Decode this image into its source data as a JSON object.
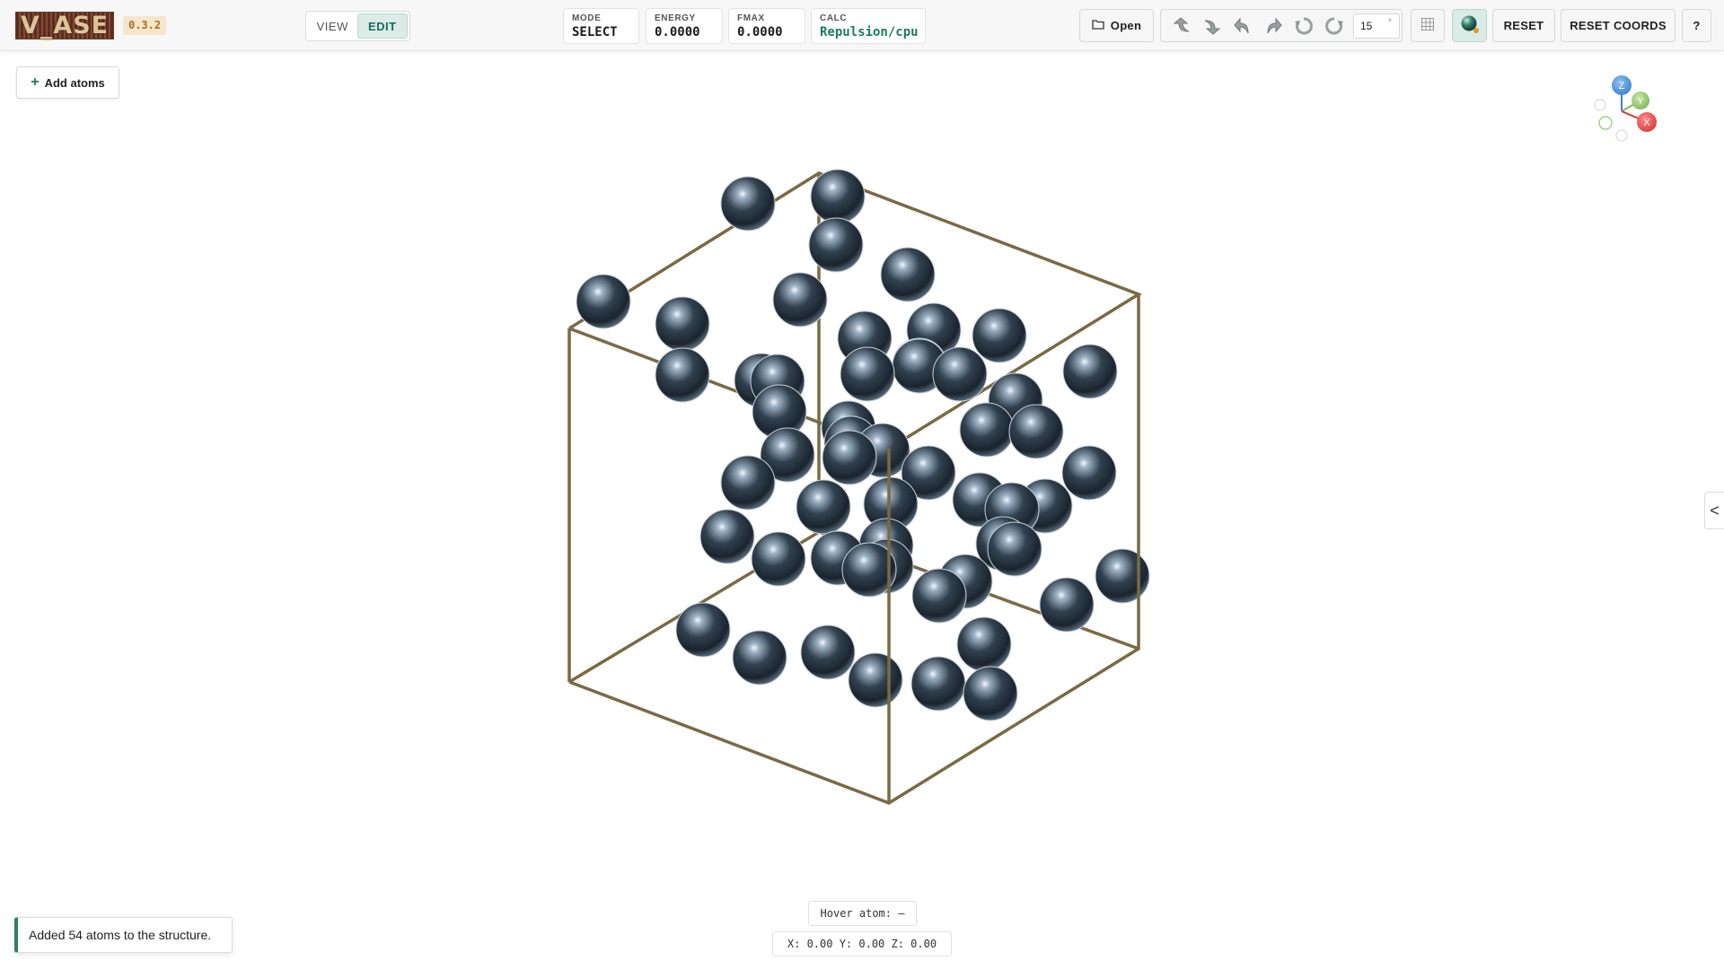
{
  "app": {
    "logo_text": "V_ASE",
    "version": "0.3.2"
  },
  "mode_toggle": {
    "options": [
      "VIEW",
      "EDIT"
    ],
    "active": "EDIT"
  },
  "stats": [
    {
      "label": "MODE",
      "value": "SELECT"
    },
    {
      "label": "ENERGY",
      "value": "0.0000"
    },
    {
      "label": "FMAX",
      "value": "0.0000"
    },
    {
      "label": "CALC",
      "value": "Repulsion/cpu"
    }
  ],
  "toolbar": {
    "open_label": "Open",
    "rotation_step": "15",
    "rotation_unit": "°",
    "reset_label": "RESET",
    "reset_coords_label": "RESET COORDS",
    "help_label": "?",
    "rotate_icons": [
      "rotate-up-icon",
      "rotate-down-icon",
      "rotate-left-icon",
      "rotate-right-icon",
      "rotate-ccw-icon",
      "rotate-cw-icon"
    ]
  },
  "canvas": {
    "add_atoms_label": "Add atoms",
    "axes": {
      "x": "X",
      "y": "Y",
      "z": "Z"
    },
    "atom_count": 54,
    "cell_color": "#7a6a45",
    "atom_color": "#2f3e4c"
  },
  "status": {
    "toast": "Added 54 atoms to the structure.",
    "hover_atom": "Hover atom: –",
    "coords": "X: 0.00 Y: 0.00 Z: 0.00"
  },
  "side_panel": {
    "toggle_label": "<"
  }
}
